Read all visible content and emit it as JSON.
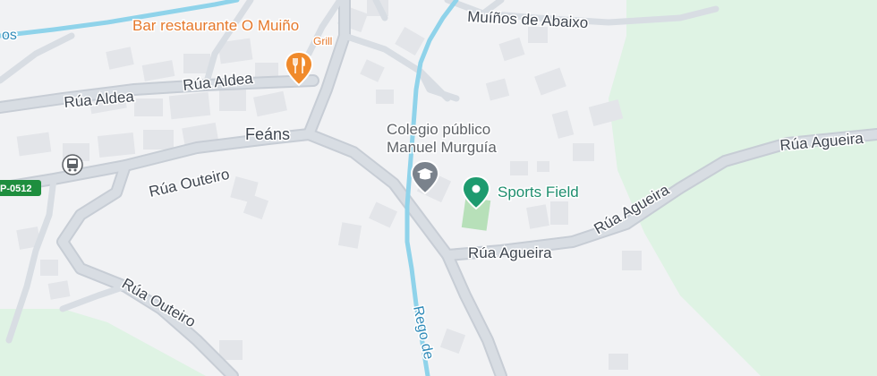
{
  "map": {
    "colors": {
      "background": "#f1f2f4",
      "park": "#dff3e4",
      "road": "#d4dae1",
      "road_edge": "#c7cdd5",
      "water": "#8fd3ea",
      "building": "#e4e6ea",
      "shield": "#1e8e3e",
      "restaurant_pin": "#f08a2b",
      "school_pin": "#7a828c",
      "sports_pin": "#1e9b6f",
      "sports_field": "#b7e0b9"
    },
    "streets": [
      {
        "id": "mulinos",
        "label": "Muíños de Abaixo"
      },
      {
        "id": "aldea1",
        "label": "Rúa Aldea"
      },
      {
        "id": "aldea2",
        "label": "Rúa Aldea"
      },
      {
        "id": "outeiro1",
        "label": "Rúa Outeiro"
      },
      {
        "id": "outeiro2",
        "label": "Rúa Outeiro"
      },
      {
        "id": "agueira1",
        "label": "Rúa Agueira"
      },
      {
        "id": "agueira2",
        "label": "Rúa Agueira"
      },
      {
        "id": "agueira3",
        "label": "Rúa Agueira"
      },
      {
        "id": "edge_left",
        "label": "os"
      }
    ],
    "water_label": "Rego de",
    "place_label": "Feáns",
    "road_shield": "P-0512",
    "pois": {
      "restaurant": {
        "name": "Bar restaurante O Muiño",
        "category": "Grill",
        "icon": "fork-knife-icon"
      },
      "school": {
        "name_line1": "Colegio público",
        "name_line2": "Manuel Murguía",
        "icon": "school-icon"
      },
      "sports": {
        "name": "Sports Field",
        "icon": "sports-field-icon"
      }
    },
    "transit": {
      "icon": "bus-stop-icon"
    }
  }
}
